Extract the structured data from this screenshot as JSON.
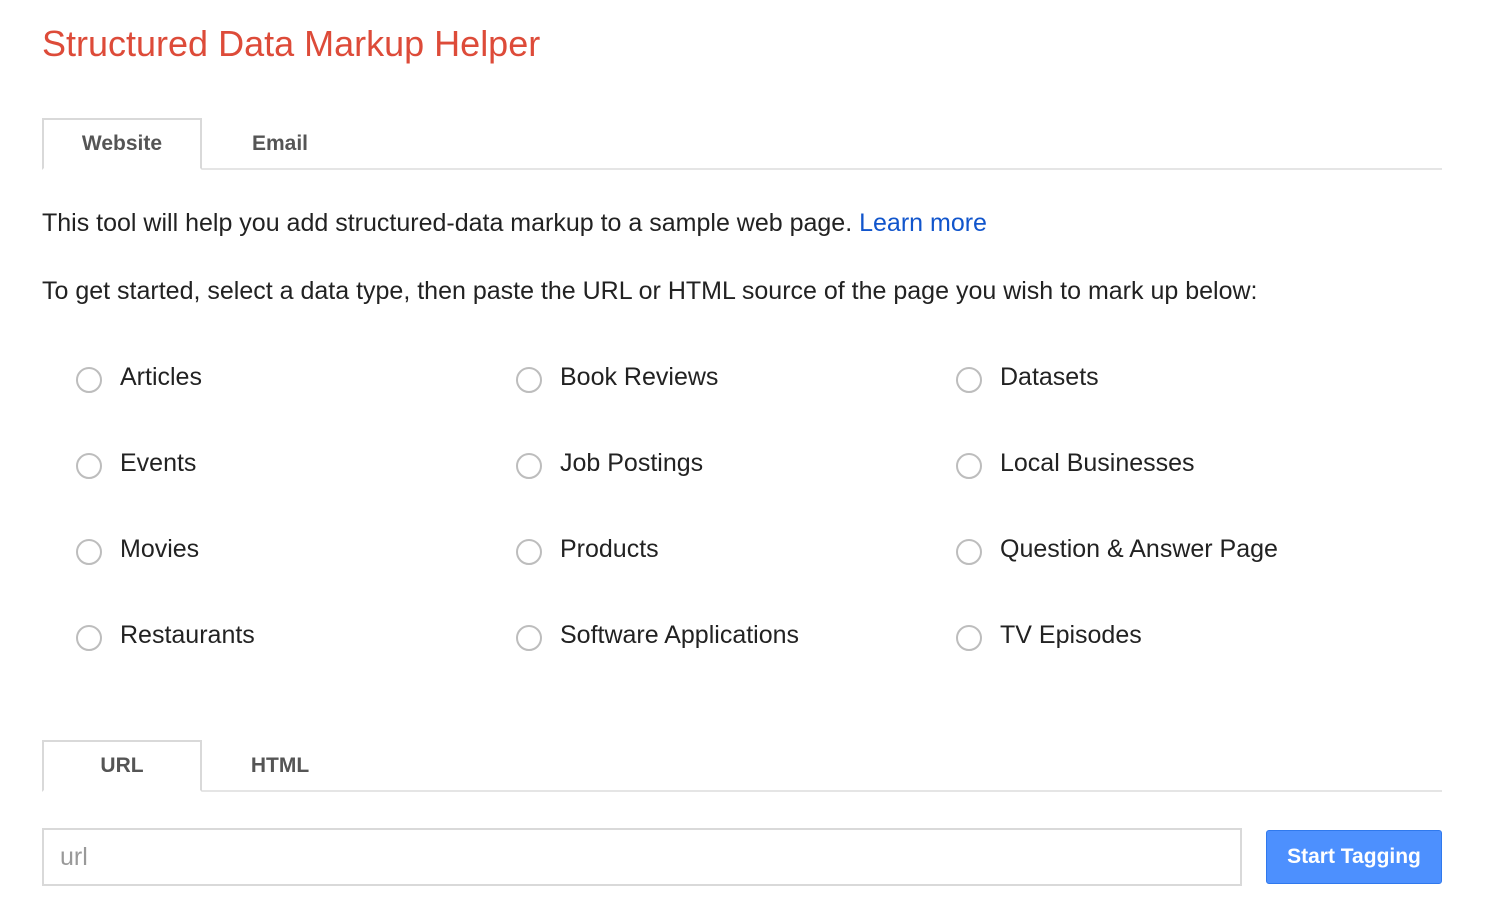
{
  "title": "Structured Data Markup Helper",
  "source_tabs": [
    {
      "label": "Website",
      "active": true
    },
    {
      "label": "Email",
      "active": false
    }
  ],
  "intro": {
    "text": "This tool will help you add structured-data markup to a sample web page. ",
    "link": "Learn more"
  },
  "instructions": "To get started, select a data type, then paste the URL or HTML source of the page you wish to mark up below:",
  "data_types": [
    {
      "label": "Articles",
      "selected": false
    },
    {
      "label": "Book Reviews",
      "selected": false
    },
    {
      "label": "Datasets",
      "selected": false
    },
    {
      "label": "Events",
      "selected": false
    },
    {
      "label": "Job Postings",
      "selected": false
    },
    {
      "label": "Local Businesses",
      "selected": false
    },
    {
      "label": "Movies",
      "selected": false
    },
    {
      "label": "Products",
      "selected": false
    },
    {
      "label": "Question & Answer Page",
      "selected": false
    },
    {
      "label": "Restaurants",
      "selected": false
    },
    {
      "label": "Software Applications",
      "selected": false
    },
    {
      "label": "TV Episodes",
      "selected": false
    }
  ],
  "input_tabs": [
    {
      "label": "URL",
      "active": true
    },
    {
      "label": "HTML",
      "active": false
    }
  ],
  "url_input": {
    "value": "",
    "placeholder": "url"
  },
  "start_button": "Start Tagging",
  "colors": {
    "title": "#dd4b39",
    "link": "#1155cc",
    "primary_button": "#4d90fe",
    "radio_border": "#bdbdbd"
  }
}
